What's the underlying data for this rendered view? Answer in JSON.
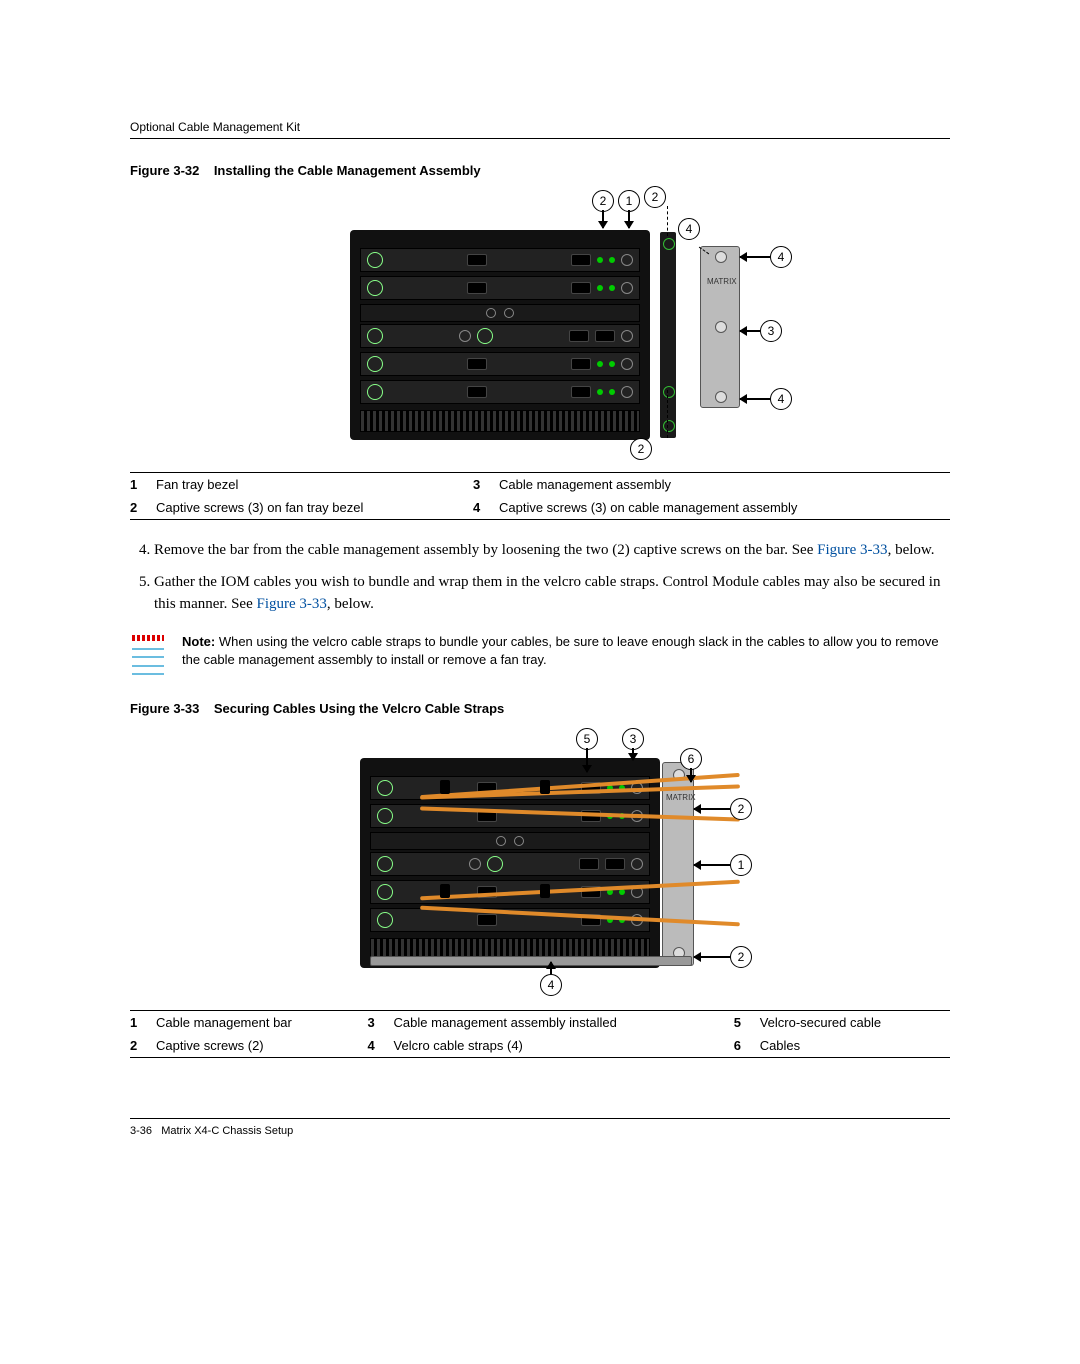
{
  "header": {
    "section": "Optional Cable Management Kit"
  },
  "figure32": {
    "caption_prefix": "Figure 3-32",
    "caption_title": "Installing the Cable Management Assembly",
    "callouts": {
      "c1": "1",
      "c2": "2",
      "c3": "3",
      "c4": "4"
    },
    "legend": [
      {
        "n": "1",
        "t": "Fan tray bezel"
      },
      {
        "n": "2",
        "t": "Captive screws (3) on fan tray bezel"
      },
      {
        "n": "3",
        "t": "Cable management assembly"
      },
      {
        "n": "4",
        "t": "Captive screws (3) on cable management assembly"
      }
    ]
  },
  "steps": {
    "start": 4,
    "s4_a": "Remove the bar from the cable management assembly by loosening the two (2) captive screws on the bar. See ",
    "s4_link": "Figure 3-33",
    "s4_b": ", below.",
    "s5_a": "Gather the IOM cables you wish to bundle and wrap them in the velcro cable straps. Control Module cables may also be secured in this manner. See ",
    "s5_link": "Figure 3-33",
    "s5_b": ", below."
  },
  "note": {
    "label": "Note:",
    "text": " When using the velcro cable straps to bundle your cables, be sure to leave enough slack in the cables to allow you to remove the cable management assembly to install or remove a fan tray."
  },
  "figure33": {
    "caption_prefix": "Figure 3-33",
    "caption_title": "Securing Cables Using the Velcro Cable Straps",
    "callouts": {
      "c1": "1",
      "c2": "2",
      "c3": "3",
      "c4": "4",
      "c5": "5",
      "c6": "6"
    },
    "legend": [
      {
        "n": "1",
        "t": "Cable management bar"
      },
      {
        "n": "2",
        "t": "Captive screws (2)"
      },
      {
        "n": "3",
        "t": "Cable management assembly installed"
      },
      {
        "n": "4",
        "t": "Velcro cable straps (4)"
      },
      {
        "n": "5",
        "t": "Velcro-secured cable"
      },
      {
        "n": "6",
        "t": "Cables"
      }
    ]
  },
  "footer": {
    "page": "3-36",
    "title": "Matrix X4-C Chassis Setup"
  }
}
